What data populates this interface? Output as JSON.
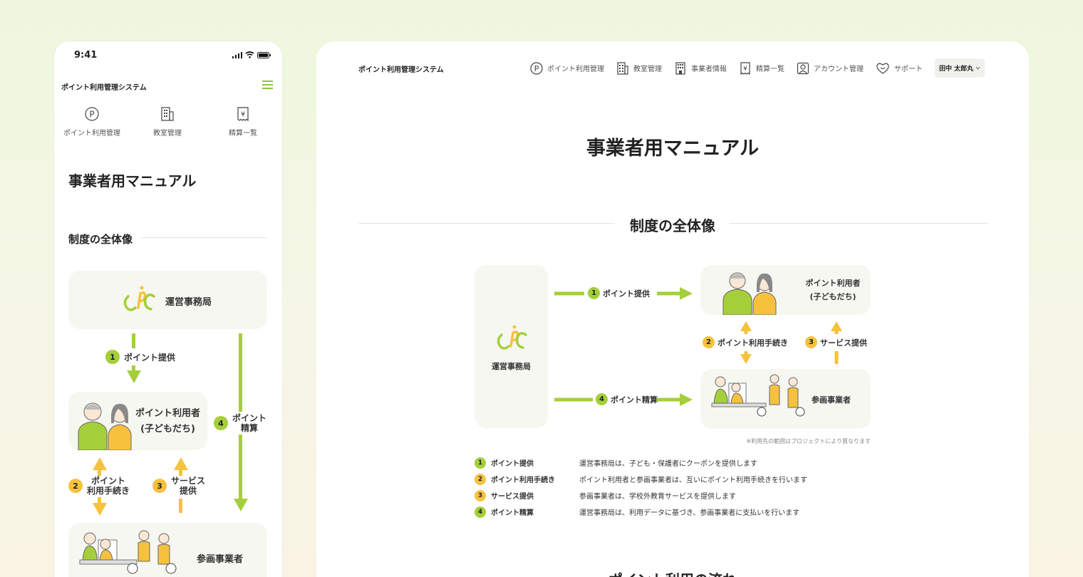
{
  "mobile": {
    "status_time": "9:41",
    "app_title": "ポイント利用管理システム",
    "nav": [
      {
        "label": "ポイント利用管理",
        "icon": "p-circle-icon"
      },
      {
        "label": "教室管理",
        "icon": "building-icon"
      },
      {
        "label": "精算一覧",
        "icon": "yen-receipt-icon"
      }
    ],
    "page_title": "事業者用マニュアル",
    "section_title": "制度の全体像",
    "office_label": "運営事務局",
    "step1": {
      "num": "1",
      "label": "ポイント提供"
    },
    "user_label_1": "ポイント利用者",
    "user_label_2": "(子どもだち)",
    "step4": {
      "num": "4",
      "line1": "ポイント",
      "line2": "精算"
    },
    "step2": {
      "num": "2",
      "line1": "ポイント",
      "line2": "利用手続き"
    },
    "step3": {
      "num": "3",
      "line1": "サービス",
      "line2": "提供"
    },
    "provider_label": "参画事業者"
  },
  "desktop": {
    "app_title": "ポイント利用管理システム",
    "nav": [
      {
        "label": "ポイント利用管理",
        "icon": "p-circle-icon"
      },
      {
        "label": "教室管理",
        "icon": "building-icon"
      },
      {
        "label": "事業者情報",
        "icon": "office-building-icon"
      },
      {
        "label": "精算一覧",
        "icon": "yen-receipt-icon"
      },
      {
        "label": "アカウント管理",
        "icon": "user-icon"
      },
      {
        "label": "サポート",
        "icon": "heart-smile-icon"
      }
    ],
    "user_menu": "田中 太郎丸",
    "page_title": "事業者用マニュアル",
    "section_title": "制度の全体像",
    "office_label": "運営事務局",
    "flow": {
      "step1": {
        "num": "1",
        "label": "ポイント提供"
      },
      "step2": {
        "num": "2",
        "label": "ポイント利用手続き"
      },
      "step3": {
        "num": "3",
        "label": "サービス提供"
      },
      "step4": {
        "num": "4",
        "label": "ポイント精算"
      },
      "user_label_1": "ポイント利用者",
      "user_label_2": "(子どもだち)",
      "provider_label": "参画事業者"
    },
    "note": "※利用先の範囲はプロジェクトにより異なります",
    "legend": [
      {
        "num": "1",
        "title": "ポイント提供",
        "desc": "運営事務局は、子ども・保護者にクーポンを提供します",
        "color": "#a5cf3a"
      },
      {
        "num": "2",
        "title": "ポイント利用手続き",
        "desc": "ポイント利用者と参画事業者は、互いにポイント利用手続きを行います",
        "color": "#f6c23e"
      },
      {
        "num": "3",
        "title": "サービス提供",
        "desc": "参画事業者は、学校外教育サービスを提供します",
        "color": "#f6c23e"
      },
      {
        "num": "4",
        "title": "ポイント精算",
        "desc": "運営事務局は、利用データに基づき、参画事業者に支払いを行います",
        "color": "#a5cf3a"
      }
    ],
    "next_section_partial": "ポイント利用の流れ"
  },
  "colors": {
    "green": "#a5cf3a",
    "yellow": "#f6c23e",
    "accent_green": "#8cc63f"
  }
}
